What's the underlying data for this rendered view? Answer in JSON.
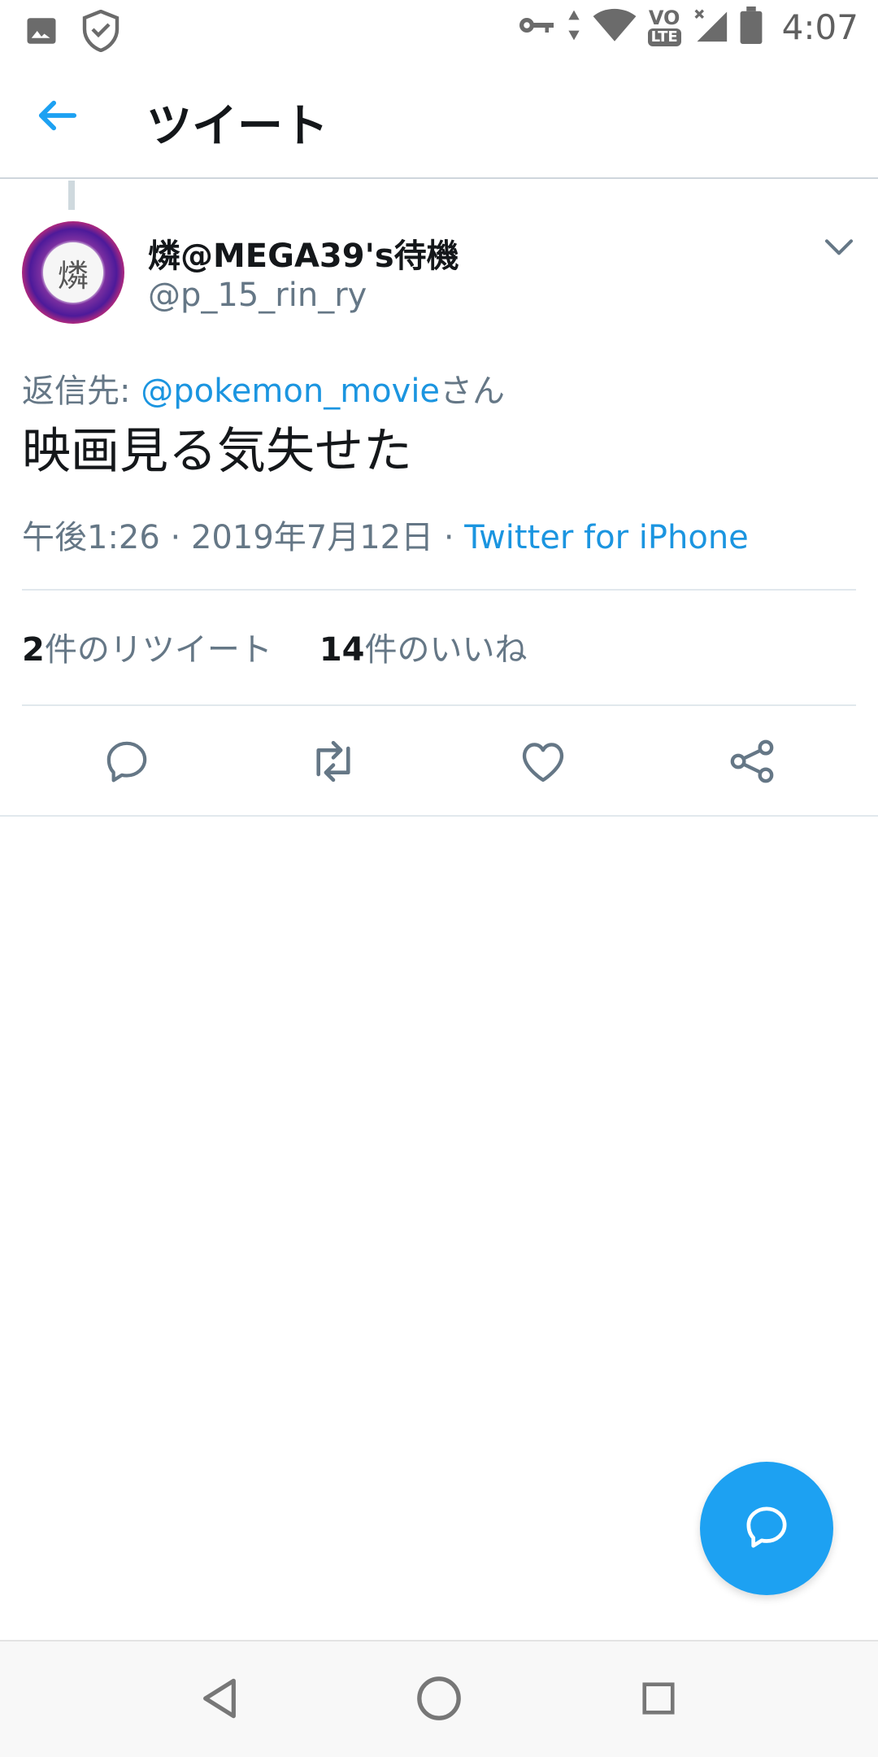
{
  "status_bar": {
    "time": "4:07",
    "network": "VO LTE",
    "icons": [
      "image-icon",
      "shield-check-icon",
      "key-icon",
      "data-arrows-icon",
      "wifi-icon",
      "volte-icon",
      "signal-icon",
      "battery-icon"
    ]
  },
  "header": {
    "title": "ツイート",
    "back_icon": "arrow-left-icon"
  },
  "tweet": {
    "avatar_text": "燐",
    "user_name": "燐@MEGA39's待機",
    "user_handle": "@p_15_rin_ry",
    "reply_prefix": "返信先: ",
    "reply_mention": "@pokemon_movie",
    "reply_suffix": "さん",
    "text": "映画見る気失せた",
    "time": "午後1:26 · 2019年7月12日 · ",
    "source": "Twitter for iPhone"
  },
  "stats": {
    "retweets_count": "2",
    "retweets_label": "件のリツイート",
    "likes_count": "14",
    "likes_label": "件のいいね"
  },
  "actions": [
    "reply-icon",
    "retweet-icon",
    "like-icon",
    "share-icon"
  ],
  "colors": {
    "accent": "#1da1f2",
    "link": "#1b95e0",
    "text_primary": "#14171a",
    "text_secondary": "#657786"
  }
}
